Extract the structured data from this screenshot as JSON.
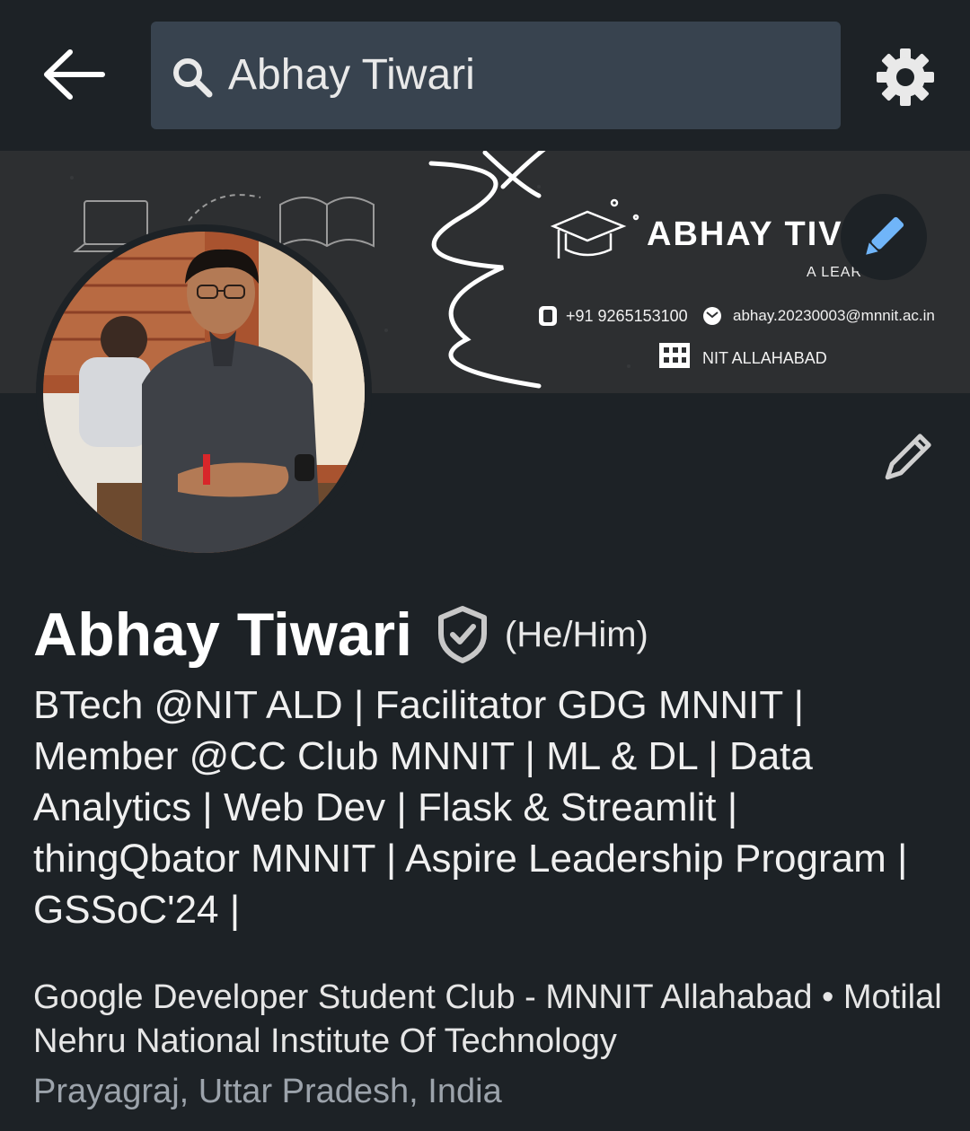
{
  "search": {
    "value": "Abhay Tiwari"
  },
  "banner": {
    "name": "ABHAY TIV",
    "tagline": "A LEAR",
    "phone": "+91 9265153100",
    "email": "abhay.20230003@mnnit.ac.in",
    "institute": "NIT ALLAHABAD"
  },
  "profile": {
    "name": "Abhay Tiwari",
    "pronouns": "(He/Him)",
    "headline": "BTech @NIT ALD | Facilitator GDG MNNIT | Member @CC Club MNNIT | ML & DL | Data Analytics | Web Dev | Flask & Streamlit | thingQbator MNNIT | Aspire Leadership Program | GSSoC'24 |",
    "affiliation": "Google Developer Student Club - MNNIT Allahabad • Motilal Nehru National Institute Of Technology",
    "location": "Prayagraj, Uttar Pradesh, India"
  },
  "icons": {
    "back": "arrow-left-icon",
    "search": "search-icon",
    "settings": "gear-icon",
    "edit": "pencil-icon",
    "verified": "shield-check-icon"
  },
  "colors": {
    "background": "#1d2226",
    "search_bg": "#38434f",
    "accent_blue": "#70b5f9",
    "muted_text": "#9ca3ab"
  }
}
